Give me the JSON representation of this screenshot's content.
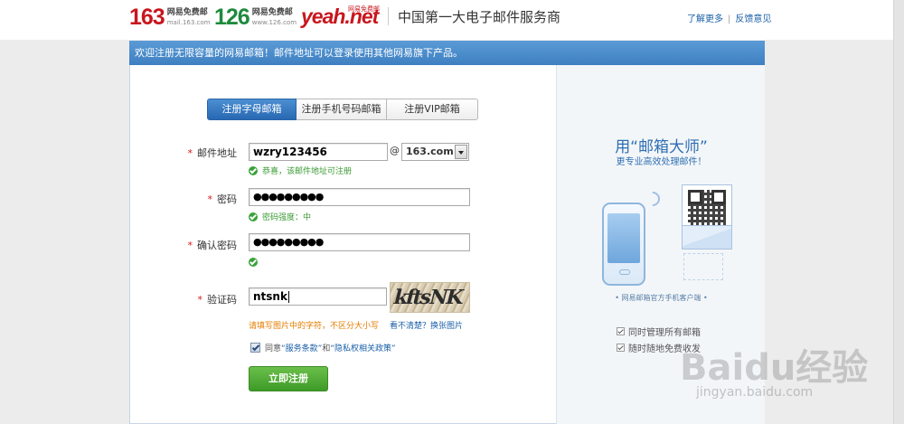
{
  "header": {
    "logos": [
      {
        "text": "163",
        "sub": "网易免费邮",
        "url_text": "mail.163.com"
      },
      {
        "text": "126",
        "sub": "网易免费邮",
        "url_text": "www.126.com"
      },
      {
        "text": "yeah.net",
        "sub": "网易免费邮"
      }
    ],
    "slogan": "中国第一大电子邮件服务商",
    "links": [
      "了解更多",
      "反馈意见"
    ]
  },
  "banner": "欢迎注册无限容量的网易邮箱！邮件地址可以登录使用其他网易旗下产品。",
  "tabs": [
    {
      "label": "注册字母邮箱",
      "active": true
    },
    {
      "label": "注册手机号码邮箱",
      "active": false
    },
    {
      "label": "注册VIP邮箱",
      "active": false
    }
  ],
  "form": {
    "required_mark": "*",
    "email": {
      "label": "邮件地址",
      "value": "wzry123456",
      "at": "@",
      "domain": "163.com",
      "hint": "恭喜，该邮件地址可注册"
    },
    "password": {
      "label": "密码",
      "value": "●●●●●●●●●",
      "hint": "密码强度：中"
    },
    "confirm": {
      "label": "确认密码",
      "value": "●●●●●●●●●"
    },
    "captcha": {
      "label": "验证码",
      "value": "ntsnk",
      "image_text": "kftsNK",
      "hint": "请填写图片中的字符，不区分大小写",
      "refresh": "看不清楚？换张图片"
    },
    "agree": {
      "prefix": "同意",
      "terms": "“服务条款”",
      "and": "和",
      "privacy": "“隐私权相关政策”"
    },
    "submit": "立即注册"
  },
  "promo": {
    "title": "用“邮箱大师”",
    "subtitle": "更专业高效处理邮件！",
    "client": "• 网易邮箱官方手机客户端 •",
    "features": [
      "同时管理所有邮箱",
      "随时随地免费收发"
    ]
  },
  "watermark": {
    "text": "Baidu经验",
    "url": "jingyan.baidu.com"
  }
}
